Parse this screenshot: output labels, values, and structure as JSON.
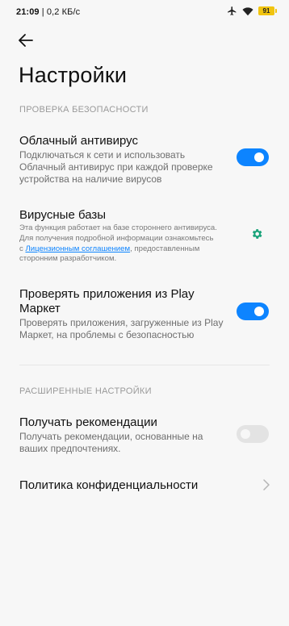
{
  "status_bar": {
    "time": "21:09",
    "network_speed": "0,2 КБ/с",
    "battery_level": "91",
    "icons": [
      "airplane-icon",
      "wifi-icon",
      "battery-icon"
    ]
  },
  "header": {
    "title": "Настройки"
  },
  "sections": {
    "security": {
      "header": "ПРОВЕРКА БЕЗОПАСНОСТИ",
      "cloud_antivirus": {
        "title": "Облачный антивирус",
        "description_line1": "Подключаться к сети и использовать",
        "description_line2": "Облачный антивирус при каждой проверке",
        "description_line3": "устройства на наличие вирусов",
        "enabled": true
      },
      "virus_db": {
        "title": "Вирусные базы",
        "description_line1": "Эта функция работает на базе стороннего антивируса.",
        "description_line2": "Для получения подробной информации ознакомьтесь",
        "description_prefix": "с ",
        "link_text": "Лицензионным соглашением",
        "description_suffix": ", предоставленным",
        "description_line4": "сторонним разработчиком."
      },
      "play_check": {
        "title_line1": "Проверять приложения из Play",
        "title_line2": "Маркет",
        "description_line1": "Проверять приложения, загруженные из Play",
        "description_line2": "Маркет, на проблемы с безопасностью",
        "enabled": true
      }
    },
    "advanced": {
      "header": "РАСШИРЕННЫЕ НАСТРОЙКИ",
      "recommendations": {
        "title": "Получать рекомендации",
        "description_line1": "Получать рекомендации, основанные на",
        "description_line2": "ваших предпочтениях.",
        "enabled": false
      },
      "privacy": {
        "title": "Политика конфиденциальности"
      }
    }
  },
  "colors": {
    "accent": "#0d84ff",
    "gear": "#1aa37a",
    "background": "#f7f7f7"
  }
}
